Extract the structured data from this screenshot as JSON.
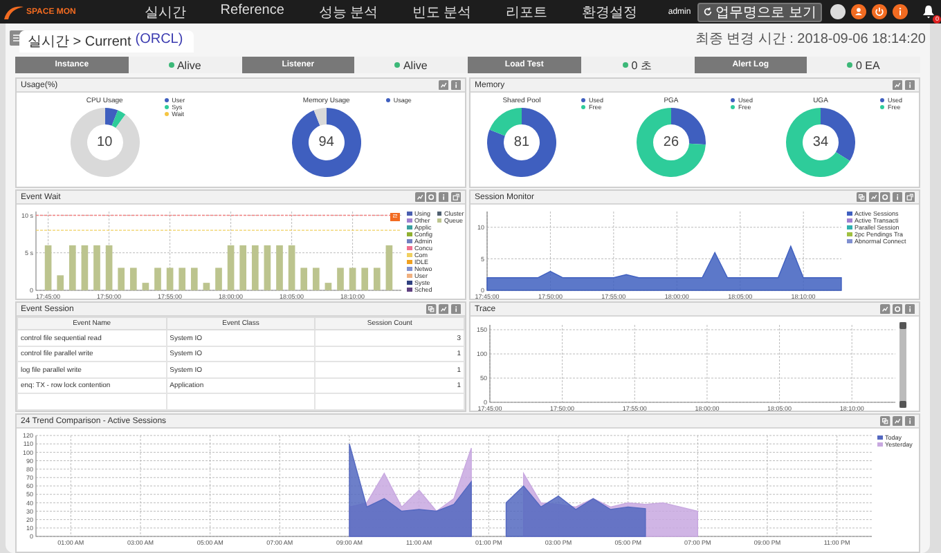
{
  "header": {
    "logo": "SPACE MON",
    "menu": [
      {
        "label": "실시간"
      },
      {
        "label": "Reference"
      },
      {
        "label": "성능 분석"
      },
      {
        "label": "빈도 분석"
      },
      {
        "label": "리포트"
      },
      {
        "label": "환경설정"
      }
    ],
    "user": "admin",
    "view_button": "업무명으로 보기",
    "actions": [
      {
        "kind": "avatar"
      },
      {
        "kind": "user"
      },
      {
        "kind": "power"
      },
      {
        "kind": "info"
      }
    ],
    "notification_count": "0"
  },
  "breadcrumb": {
    "path": "실시간 > Current",
    "instance": "(ORCL)"
  },
  "last_update": "최종 변경 시간 : 2018-09-06 18:14:20",
  "status": [
    {
      "label": "Instance",
      "value": "Alive",
      "color": "#3cb878"
    },
    {
      "label": "Listener",
      "value": "Alive",
      "color": "#3cb878"
    },
    {
      "label": "Load Test",
      "value": "0 초",
      "color": "#3cb878"
    },
    {
      "label": "Alert Log",
      "value": "0 EA",
      "color": "#3cb878"
    }
  ],
  "usage": {
    "title": "Usage(%)",
    "tools": [
      {
        "kind": "chart"
      },
      {
        "kind": "info"
      }
    ],
    "charts": [
      {
        "title": "CPU Usage",
        "center": "10",
        "chart_data": {
          "type": "donut",
          "categories": [
            "User",
            "Sys",
            "Wait",
            null
          ],
          "colors": [
            "#3f5fbf",
            "#2ecc9a",
            "#f5c542",
            "#d9d9d9"
          ],
          "values": [
            6,
            4,
            0,
            90
          ]
        }
      },
      {
        "title": "Memory Usage",
        "center": "94",
        "chart_data": {
          "type": "donut",
          "categories": [
            "Usage",
            null
          ],
          "colors": [
            "#3f5fbf",
            "#d9d9d9"
          ],
          "values": [
            94,
            6
          ]
        }
      }
    ]
  },
  "memory": {
    "title": "Memory",
    "tools": [
      {
        "kind": "chart"
      },
      {
        "kind": "info"
      }
    ],
    "charts": [
      {
        "title": "Shared Pool",
        "center": "81",
        "chart_data": {
          "type": "donut",
          "categories": [
            "Used",
            "Free"
          ],
          "colors": [
            "#3f5fbf",
            "#2ecc9a"
          ],
          "values": [
            81,
            19
          ]
        }
      },
      {
        "title": "PGA",
        "center": "26",
        "chart_data": {
          "type": "donut",
          "categories": [
            "Used",
            "Free"
          ],
          "colors": [
            "#3f5fbf",
            "#2ecc9a"
          ],
          "values": [
            26,
            74
          ]
        }
      },
      {
        "title": "UGA",
        "center": "34",
        "chart_data": {
          "type": "donut",
          "categories": [
            "Used",
            "Free"
          ],
          "colors": [
            "#3f5fbf",
            "#2ecc9a"
          ],
          "values": [
            34,
            66
          ]
        }
      }
    ]
  },
  "event_wait": {
    "title": "Event Wait",
    "tools": [
      {
        "kind": "chart"
      },
      {
        "kind": "settings"
      },
      {
        "kind": "info"
      },
      {
        "kind": "popout"
      }
    ],
    "alert": "ㄹ",
    "legend": [
      {
        "name": "Using",
        "color": "#4a5fb0"
      },
      {
        "name": "Other",
        "color": "#a080d0"
      },
      {
        "name": "Applic",
        "color": "#3aa0a0"
      },
      {
        "name": "Config",
        "color": "#90b030"
      },
      {
        "name": "Admin",
        "color": "#7080c0"
      },
      {
        "name": "Concu",
        "color": "#f07090"
      },
      {
        "name": "Com",
        "color": "#f0d060"
      },
      {
        "name": "IDLE",
        "color": "#f0a020"
      },
      {
        "name": "Netwo",
        "color": "#8090d0"
      },
      {
        "name": "User",
        "color": "#f0b080"
      },
      {
        "name": "Syste",
        "color": "#304080"
      },
      {
        "name": "Sched",
        "color": "#604080"
      },
      {
        "name": "Cluster",
        "color": "#506070"
      }
    ],
    "chart_data": {
      "type": "bar",
      "grid": true,
      "categories": [
        "17:45:00",
        null,
        null,
        null,
        null,
        "17:50:00",
        null,
        null,
        null,
        null,
        "17:55:00",
        null,
        null,
        null,
        null,
        "18:00:00",
        null,
        null,
        null,
        null,
        "18:05:00",
        null,
        null,
        null,
        null,
        "18:10:00",
        null,
        null,
        null
      ],
      "ylim": [
        0,
        10.5
      ],
      "yticks": [
        {
          "value": 0,
          "label": "0"
        },
        {
          "value": 5,
          "label": "5 s"
        },
        {
          "value": 10,
          "label": "10 s"
        }
      ],
      "series": [
        {
          "name": "Queue",
          "color": "#bcc48e",
          "values": [
            6,
            2,
            6,
            6,
            6,
            6,
            3,
            3,
            1,
            3,
            3,
            3,
            3,
            1,
            3,
            6,
            6,
            6,
            6,
            6,
            6,
            3,
            3,
            1,
            3,
            3,
            3,
            3,
            6
          ]
        }
      ],
      "ref_lines": [
        {
          "axis": "y",
          "value": 10,
          "color": "#f08080"
        },
        {
          "axis": "y",
          "value": 8,
          "color": "#f0d060"
        }
      ]
    }
  },
  "session_monitor": {
    "title": "Session Monitor",
    "tools": [
      {
        "kind": "expand"
      },
      {
        "kind": "chart"
      },
      {
        "kind": "settings"
      },
      {
        "kind": "info"
      },
      {
        "kind": "popout"
      }
    ],
    "chart_data": {
      "type": "area",
      "grid": true,
      "categories": [
        "17:45:00",
        null,
        null,
        null,
        null,
        "17:50:00",
        null,
        null,
        null,
        null,
        "17:55:00",
        null,
        null,
        null,
        null,
        "18:00:00",
        null,
        null,
        null,
        null,
        "18:05:00",
        null,
        null,
        null,
        null,
        "18:10:00",
        null,
        null,
        null
      ],
      "ylim": [
        0,
        12.5
      ],
      "yticks": [
        0,
        5,
        10
      ],
      "series": [
        {
          "name": "Active Sessions",
          "color": "#4060c0",
          "values": [
            2,
            2,
            2,
            2,
            2,
            3,
            2,
            2,
            2,
            2,
            2,
            2.5,
            2,
            2,
            2,
            2,
            2,
            2,
            6,
            2,
            2,
            2,
            2,
            2,
            7,
            2,
            2,
            2,
            2
          ]
        }
      ]
    },
    "legend": [
      {
        "name": "Active Transacti",
        "color": "#a080d0"
      },
      {
        "name": "Parallel Session",
        "color": "#30b0b0"
      },
      {
        "name": "2pc Pendings Tra",
        "color": "#a0c040"
      },
      {
        "name": "Abnormal Connect",
        "color": "#8090d0"
      }
    ]
  },
  "event_session": {
    "title": "Event Session",
    "tools": [
      {
        "kind": "expand"
      },
      {
        "kind": "chart"
      },
      {
        "kind": "info"
      }
    ],
    "columns": [
      "Event Name",
      "Event Class",
      "Session Count"
    ],
    "rows": [
      [
        "control file sequential read",
        "System IO",
        "3"
      ],
      [
        "control file parallel write",
        "System IO",
        "1"
      ],
      [
        "log file parallel write",
        "System IO",
        "1"
      ],
      [
        "enq: TX - row lock contention",
        "Application",
        "1"
      ]
    ]
  },
  "trace": {
    "title": "Trace",
    "tools": [
      {
        "kind": "chart"
      },
      {
        "kind": "settings"
      },
      {
        "kind": "info"
      }
    ],
    "chart_data": {
      "type": "scatter",
      "grid": true,
      "categories": [
        "17:45:00",
        null,
        null,
        null,
        null,
        "17:50:00",
        null,
        null,
        null,
        null,
        "17:55:00",
        null,
        null,
        null,
        null,
        "18:00:00",
        null,
        null,
        null,
        null,
        "18:05:00",
        null,
        null,
        null,
        null,
        "18:10:00",
        null,
        null,
        null
      ],
      "ylim": [
        0,
        160
      ],
      "yticks": [
        0,
        50,
        100,
        150
      ]
    },
    "zoom_range": {
      "level": 1
    }
  },
  "trend": {
    "title": "24 Trend Comparison - Active Sessions",
    "tools": [
      {
        "kind": "expand"
      },
      {
        "kind": "chart"
      },
      {
        "kind": "info"
      }
    ],
    "chart_data": {
      "type": "area",
      "grid": true,
      "categories": [
        null,
        null,
        "01:00 AM",
        null,
        null,
        null,
        "03:00 AM",
        null,
        null,
        null,
        "05:00 AM",
        null,
        null,
        null,
        "07:00 AM",
        null,
        null,
        null,
        "09:00 AM",
        null,
        null,
        null,
        "11:00 AM",
        null,
        null,
        null,
        "01:00 PM",
        null,
        null,
        null,
        "03:00 PM",
        null,
        null,
        null,
        "05:00 PM",
        null,
        null,
        null,
        "07:00 PM",
        null,
        null,
        null,
        "09:00 PM",
        null,
        null,
        null,
        "11:00 PM",
        null,
        null
      ],
      "ylim": [
        0,
        120
      ],
      "yticks": [
        0,
        10,
        20,
        30,
        40,
        50,
        60,
        70,
        80,
        90,
        100,
        110,
        120
      ],
      "series": [
        {
          "name": "Yesterday",
          "color": "#c8a8e0",
          "values": [
            null,
            null,
            null,
            null,
            null,
            null,
            null,
            null,
            null,
            null,
            null,
            null,
            null,
            null,
            null,
            null,
            null,
            null,
            35,
            40,
            75,
            35,
            55,
            30,
            45,
            105,
            null,
            null,
            75,
            40,
            38,
            35,
            45,
            35,
            40,
            38,
            40,
            35,
            30,
            null,
            null,
            null,
            null,
            null,
            null,
            null,
            null,
            null,
            null
          ]
        },
        {
          "name": "Today",
          "color": "#5468c0",
          "values": [
            null,
            null,
            null,
            null,
            null,
            null,
            null,
            null,
            null,
            null,
            null,
            null,
            null,
            null,
            null,
            null,
            null,
            null,
            110,
            35,
            45,
            30,
            32,
            30,
            38,
            65,
            null,
            40,
            60,
            35,
            48,
            32,
            45,
            32,
            35,
            33,
            null,
            null,
            null,
            null,
            null,
            null,
            null,
            null,
            null,
            null,
            null,
            null,
            null
          ]
        }
      ]
    }
  }
}
